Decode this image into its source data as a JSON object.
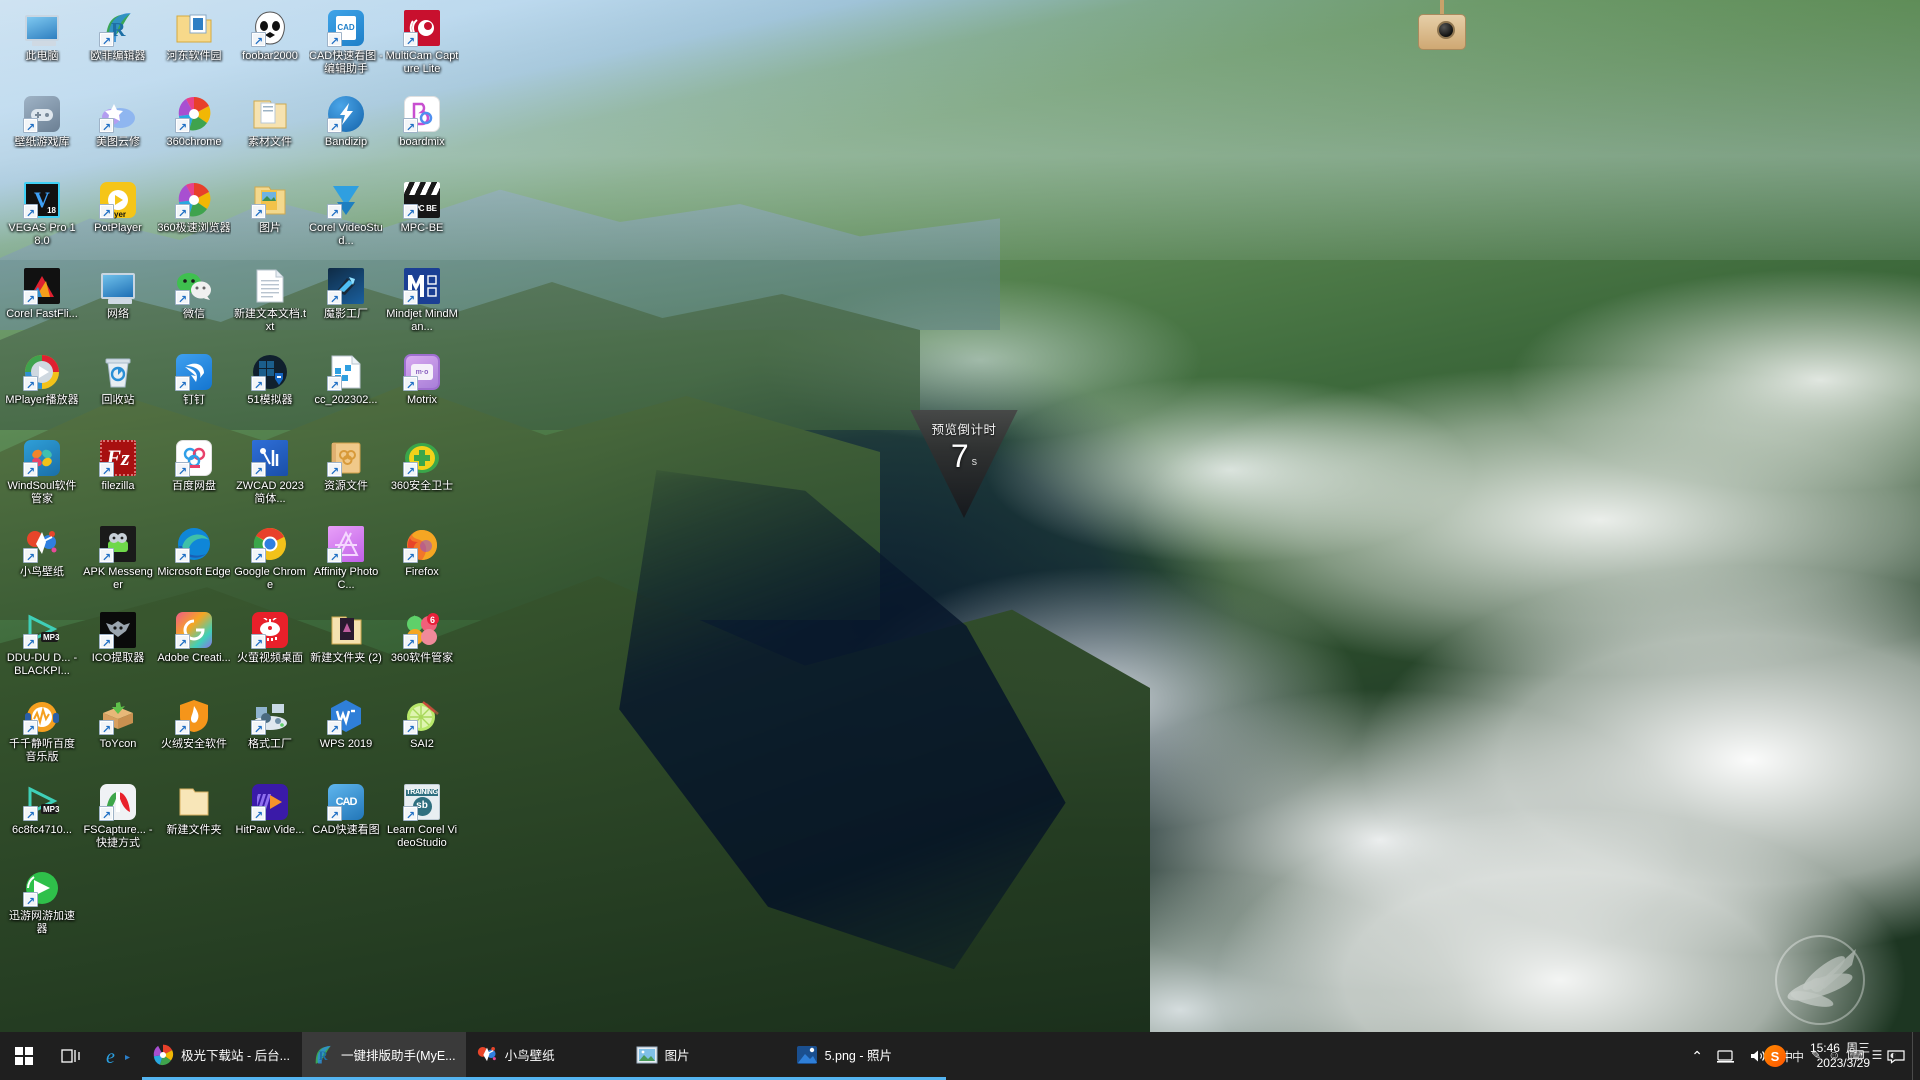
{
  "desktop": {
    "icons": [
      {
        "label": "此电脑",
        "icon": "this-pc-icon",
        "shortcut": false
      },
      {
        "label": "欧菲编辑器",
        "icon": "oufei-editor-icon",
        "shortcut": true
      },
      {
        "label": "河东软件园",
        "icon": "hedong-software-folder-icon",
        "shortcut": false
      },
      {
        "label": "foobar2000",
        "icon": "foobar2000-icon",
        "shortcut": true
      },
      {
        "label": "CAD快速看图 - 编辑助手",
        "icon": "cad-quick-view-icon",
        "shortcut": true
      },
      {
        "label": "MultiCam Capture Lite",
        "icon": "multicam-capture-lite-icon",
        "shortcut": true
      },
      {
        "label": "壁纸游戏库",
        "icon": "wallpaper-game-library-icon",
        "shortcut": true
      },
      {
        "label": "美图云修",
        "icon": "meitu-yunxiu-icon",
        "shortcut": true
      },
      {
        "label": "360chrome",
        "icon": "360chrome-icon",
        "shortcut": true
      },
      {
        "label": "素材文件",
        "icon": "materials-folder-icon",
        "shortcut": false
      },
      {
        "label": "Bandizip",
        "icon": "bandizip-icon",
        "shortcut": true
      },
      {
        "label": "boardmix",
        "icon": "boardmix-icon",
        "shortcut": true
      },
      {
        "label": "VEGAS Pro 18.0",
        "icon": "vegas-pro-18-icon",
        "shortcut": true
      },
      {
        "label": "PotPlayer",
        "icon": "potplayer-icon",
        "shortcut": true
      },
      {
        "label": "360极速浏览器",
        "icon": "360-speed-browser-icon",
        "shortcut": true
      },
      {
        "label": "图片",
        "icon": "pictures-folder-icon",
        "shortcut": true
      },
      {
        "label": "Corel VideoStud...",
        "icon": "corel-videostudio-icon",
        "shortcut": true
      },
      {
        "label": "MPC-BE",
        "icon": "mpc-be-icon",
        "shortcut": true
      },
      {
        "label": "Corel FastFli...",
        "icon": "corel-fastflick-icon",
        "shortcut": true
      },
      {
        "label": "网络",
        "icon": "network-icon",
        "shortcut": false
      },
      {
        "label": "微信",
        "icon": "wechat-icon",
        "shortcut": true
      },
      {
        "label": "新建文本文档.txt",
        "icon": "text-document-icon",
        "shortcut": false
      },
      {
        "label": "魔影工厂",
        "icon": "moying-factory-icon",
        "shortcut": true
      },
      {
        "label": "Mindjet MindMan...",
        "icon": "mindjet-mindmanager-icon",
        "shortcut": true
      },
      {
        "label": "MPlayer播放器",
        "icon": "mplayer-icon",
        "shortcut": true
      },
      {
        "label": "回收站",
        "icon": "recycle-bin-icon",
        "shortcut": false
      },
      {
        "label": "钉钉",
        "icon": "dingtalk-icon",
        "shortcut": true
      },
      {
        "label": "51模拟器",
        "icon": "51-emulator-icon",
        "shortcut": true
      },
      {
        "label": "cc_202302...",
        "icon": "cc-file-icon",
        "shortcut": true
      },
      {
        "label": "Motrix",
        "icon": "motrix-icon",
        "shortcut": true
      },
      {
        "label": "WindSoul软件管家",
        "icon": "windsoul-software-manager-icon",
        "shortcut": true
      },
      {
        "label": "filezilla",
        "icon": "filezilla-icon",
        "shortcut": true
      },
      {
        "label": "百度网盘",
        "icon": "baidu-netdisk-icon",
        "shortcut": true
      },
      {
        "label": "ZWCAD 2023 简体...",
        "icon": "zwcad-2023-icon",
        "shortcut": true
      },
      {
        "label": "资源文件",
        "icon": "resources-folder-icon",
        "shortcut": true
      },
      {
        "label": "360安全卫士",
        "icon": "360-safe-guard-icon",
        "shortcut": true
      },
      {
        "label": "小鸟壁纸",
        "icon": "xiaoniao-wallpaper-icon",
        "shortcut": true
      },
      {
        "label": "APK Messenger",
        "icon": "apk-messenger-icon",
        "shortcut": true
      },
      {
        "label": "Microsoft Edge",
        "icon": "microsoft-edge-icon",
        "shortcut": true
      },
      {
        "label": "Google Chrome",
        "icon": "google-chrome-icon",
        "shortcut": true
      },
      {
        "label": "Affinity Photo C...",
        "icon": "affinity-photo-icon",
        "shortcut": true
      },
      {
        "label": "Firefox",
        "icon": "firefox-icon",
        "shortcut": true
      },
      {
        "label": "DDU-DU D... - BLACKPI...",
        "icon": "mp3-file-icon",
        "shortcut": true
      },
      {
        "label": "ICO提取器",
        "icon": "ico-extractor-icon",
        "shortcut": true
      },
      {
        "label": "Adobe Creati...",
        "icon": "adobe-creative-cloud-icon",
        "shortcut": true
      },
      {
        "label": "火萤视频桌面",
        "icon": "huoying-video-desktop-icon",
        "shortcut": true
      },
      {
        "label": "新建文件夹 (2)",
        "icon": "new-folder-2-icon",
        "shortcut": false
      },
      {
        "label": "360软件管家",
        "icon": "360-software-manager-icon",
        "shortcut": true
      },
      {
        "label": "千千静听百度音乐版",
        "icon": "qianqian-music-icon",
        "shortcut": true
      },
      {
        "label": "ToYcon",
        "icon": "toycon-icon",
        "shortcut": true
      },
      {
        "label": "火绒安全软件",
        "icon": "huorong-security-icon",
        "shortcut": true
      },
      {
        "label": "格式工厂",
        "icon": "format-factory-icon",
        "shortcut": true
      },
      {
        "label": "WPS 2019",
        "icon": "wps-2019-icon",
        "shortcut": true
      },
      {
        "label": "SAI2",
        "icon": "sai2-icon",
        "shortcut": true
      },
      {
        "label": "6c8fc4710...",
        "icon": "mp3-file-icon",
        "shortcut": true
      },
      {
        "label": "FSCapture... - 快捷方式",
        "icon": "fscapture-icon",
        "shortcut": true
      },
      {
        "label": "新建文件夹",
        "icon": "new-folder-icon",
        "shortcut": false
      },
      {
        "label": "HitPaw Vide...",
        "icon": "hitpaw-video-icon",
        "shortcut": true
      },
      {
        "label": "CAD快速看图",
        "icon": "cad-quick-view-2-icon",
        "shortcut": true
      },
      {
        "label": "Learn Corel VideoStudio",
        "icon": "learn-corel-videostudio-icon",
        "shortcut": true
      },
      {
        "label": "迅游网游加速器",
        "icon": "xunyou-accelerator-icon",
        "shortcut": true
      }
    ]
  },
  "countdown": {
    "title": "预览倒计时",
    "value": "7",
    "unit": "s"
  },
  "taskbar": {
    "start_label": "开始",
    "task_view_label": "任务视图",
    "ie_label": "Internet Explorer",
    "tasks": [
      {
        "label": "极光下载站 - 后台...",
        "icon": "360-browser-icon",
        "active": false,
        "open": true
      },
      {
        "label": "一键排版助手(MyE...",
        "icon": "oufei-editor-icon",
        "active": true,
        "open": true
      },
      {
        "label": "小鸟壁纸",
        "icon": "xiaoniao-wallpaper-icon",
        "active": false,
        "open": true
      },
      {
        "label": "图片",
        "icon": "pictures-icon",
        "active": false,
        "open": true
      },
      {
        "label": "5.png - 照片",
        "icon": "photos-icon",
        "active": false,
        "open": true
      }
    ],
    "tray": {
      "chevron": "⌃",
      "network_icon": "network-tray-icon",
      "volume_icon": "volume-tray-icon",
      "ime_label": "中",
      "sogou_label": "S",
      "sogou_items": [
        "中",
        "✎",
        "☺",
        "⌨",
        "☰",
        "◐"
      ],
      "time": "15:46",
      "weekday": "周三",
      "date": "2023/3/29",
      "notification_icon": "action-center-icon"
    }
  }
}
